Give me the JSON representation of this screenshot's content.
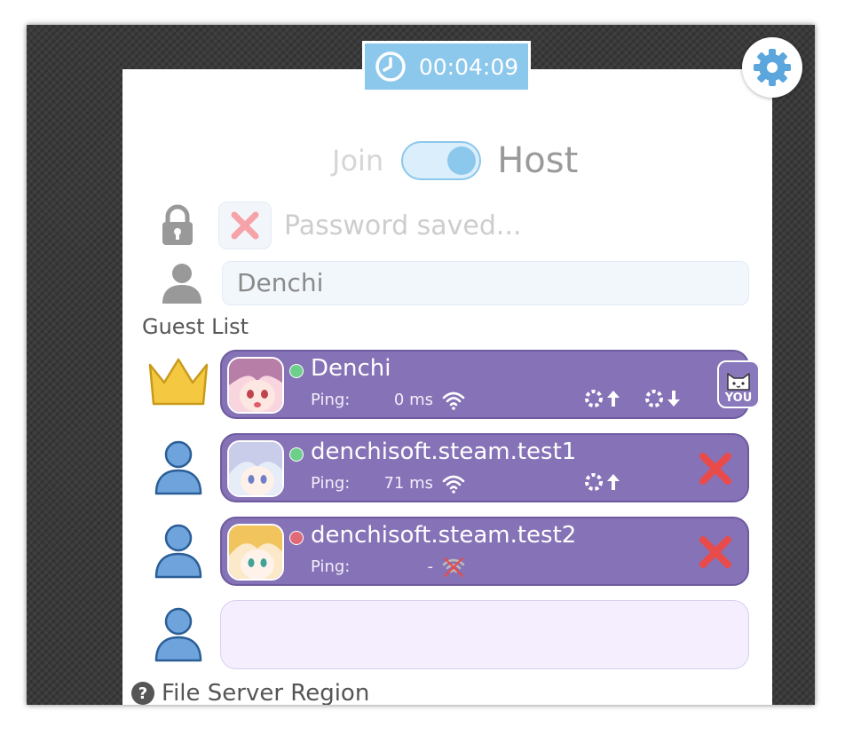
{
  "timer": {
    "elapsed": "00:04:09",
    "icon": "clock-icon"
  },
  "settings": {
    "icon": "gear-icon"
  },
  "mode": {
    "join_label": "Join",
    "host_label": "Host",
    "selected": "Host"
  },
  "password": {
    "icon": "lock-icon",
    "clear_icon": "close-icon",
    "placeholder": "Password saved..."
  },
  "username": {
    "icon": "user-icon",
    "value": "Denchi"
  },
  "guest_list": {
    "title": "Guest List",
    "ping_label": "Ping:",
    "guests": [
      {
        "role_icon": "crown-icon",
        "name": "Denchi",
        "status": "online",
        "status_color": "#6ccf8a",
        "ping": "0 ms",
        "is_you": true,
        "you_label": "YOU"
      },
      {
        "role_icon": "user-icon",
        "name": "denchisoft.steam.test1",
        "status": "online",
        "status_color": "#6ccf8a",
        "ping": "71 ms",
        "is_you": false
      },
      {
        "role_icon": "user-icon",
        "name": "denchisoft.steam.test2",
        "status": "offline",
        "status_color": "#e06a78",
        "ping": "-",
        "is_you": false
      },
      {
        "role_icon": "user-icon",
        "empty": true
      }
    ]
  },
  "file_server_region": {
    "label": "File Server Region",
    "icon": "help-icon"
  },
  "colors": {
    "accent": "#8cc7ec",
    "card": "#8672b6",
    "kick": "#e94b4b",
    "crown": "#f5c842",
    "user": "#6fa3dc"
  }
}
